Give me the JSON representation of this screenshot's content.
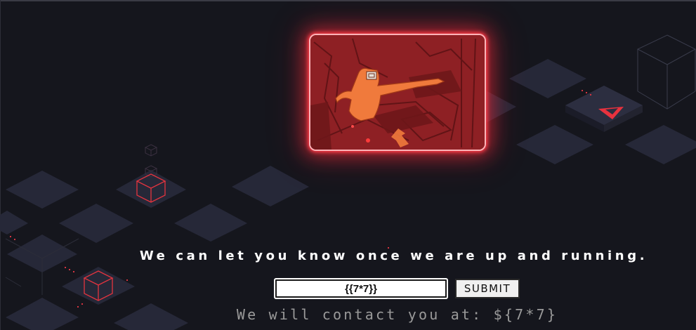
{
  "page": {
    "background_color": "#15161d",
    "accent_color": "#ff2a3c"
  },
  "hero": {
    "icon": "image-icon"
  },
  "tagline": "We can let you know once we are up and running.",
  "form": {
    "email_value": "{{7*7}}",
    "submit_label": "SUBMIT"
  },
  "result_message": "We will contact you at: ${7*7}"
}
